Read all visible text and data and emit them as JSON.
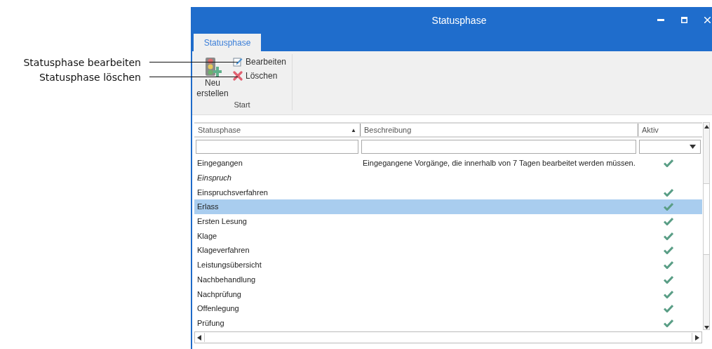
{
  "annotations": [
    {
      "text": "Statusphase bearbeiten"
    },
    {
      "text": "Statusphase löschen"
    }
  ],
  "window": {
    "title": "Statusphase"
  },
  "tabs": [
    {
      "label": "Statusphase",
      "selected": true
    }
  ],
  "ribbon": {
    "large_button": {
      "label": "Neu erstellen"
    },
    "small_buttons": [
      {
        "label": "Bearbeiten",
        "kind": "edit"
      },
      {
        "label": "Löschen",
        "kind": "delete"
      }
    ],
    "group": "Start"
  },
  "table": {
    "columns": [
      {
        "label": "Statusphase",
        "filter": {
          "kind": "text"
        },
        "sort_mark": "▲"
      },
      {
        "label": "Beschreibung",
        "filter": {
          "kind": "text"
        }
      },
      {
        "label": "Aktiv",
        "filter": {
          "kind": "dropdown"
        }
      }
    ],
    "rows": [
      {
        "name": "Eingegangen",
        "description": "Eingegangene Vorgänge, die innerhalb von 7 Tagen bearbeitet werden müssen.",
        "active": true,
        "selected": false
      },
      {
        "name": "Einspruch",
        "active": false,
        "selected": false
      },
      {
        "name": "Einspruchsverfahren",
        "active": true,
        "selected": false
      },
      {
        "name": "Erlass",
        "active": true,
        "selected": true
      },
      {
        "name": "Ersten Lesung",
        "active": true,
        "selected": false
      },
      {
        "name": "Klage",
        "active": true,
        "selected": false
      },
      {
        "name": "Klageverfahren",
        "active": true,
        "selected": false
      },
      {
        "name": "Leistungsübersicht",
        "active": true,
        "selected": false
      },
      {
        "name": "Nachbehandlung",
        "active": true,
        "selected": false
      },
      {
        "name": "Nachprüfung",
        "active": true,
        "selected": false
      },
      {
        "name": "Offenlegung",
        "active": true,
        "selected": false
      },
      {
        "name": "Prüfung",
        "active": true,
        "selected": false
      }
    ]
  }
}
